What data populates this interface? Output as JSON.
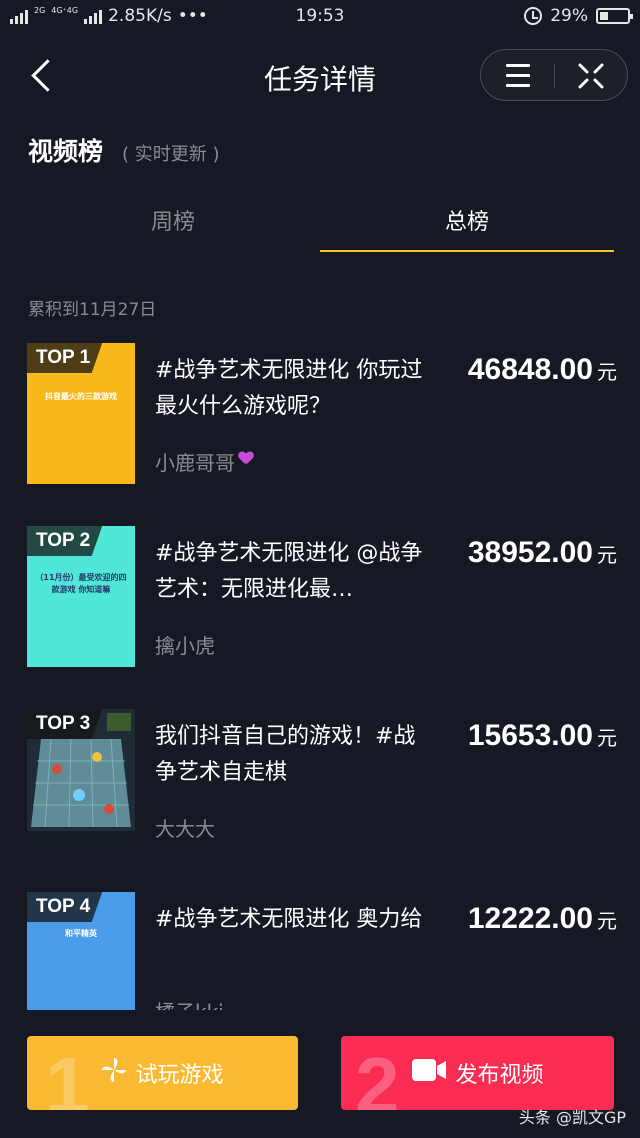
{
  "status_bar": {
    "net_label_1": "2G",
    "net_label_2": "4G⁺4G",
    "speed": "2.85K/s",
    "more": "•••",
    "time": "19:53",
    "battery": "29%",
    "battery_level": 0.29
  },
  "nav": {
    "title": "任务详情"
  },
  "header": {
    "title": "视频榜",
    "subtitle": "( 实时更新 )"
  },
  "tabs": [
    {
      "label": "周榜",
      "selected": false
    },
    {
      "label": "总榜",
      "selected": true
    }
  ],
  "cumulative_label": "累积到11月27日",
  "items": [
    {
      "rank": "TOP 1",
      "thumb_caption": "抖音最火的三款游戏",
      "thumb_color": "#fbb81b",
      "title": "#战争艺术无限进化 你玩过最火什么游戏呢？",
      "author": "小鹿哥哥",
      "amount": "46848.00",
      "unit": "元"
    },
    {
      "rank": "TOP 2",
      "thumb_caption": "（11月份）最受欢迎的四款游戏 你知道嘛",
      "thumb_color": "#4fe8d8",
      "title": "#战争艺术无限进化 @战争艺术：无限进化最…",
      "author": "擒小虎",
      "amount": "38952.00",
      "unit": "元"
    },
    {
      "rank": "TOP 3",
      "thumb_caption": "",
      "thumb_color": "#2c3a46",
      "title": "我们抖音自己的游戏！#战争艺术自走棋",
      "author": "大大大",
      "amount": "15653.00",
      "unit": "元"
    },
    {
      "rank": "TOP 4",
      "thumb_caption": "和平精英",
      "thumb_color": "#4a9de8",
      "title": "#战争艺术无限进化 奥力给",
      "author": "橘子kki",
      "amount": "12222.00",
      "unit": "元"
    }
  ],
  "buttons": {
    "try_num": "1",
    "try_label": "试玩游戏",
    "publish_num": "2",
    "publish_label": "发布视频"
  },
  "watermark": "头条 @凯文GP",
  "icons": [
    "back-icon",
    "menu-icon",
    "close-icon",
    "pinwheel-icon",
    "camera-icon",
    "alarm-icon",
    "battery-icon",
    "signal-icon"
  ]
}
